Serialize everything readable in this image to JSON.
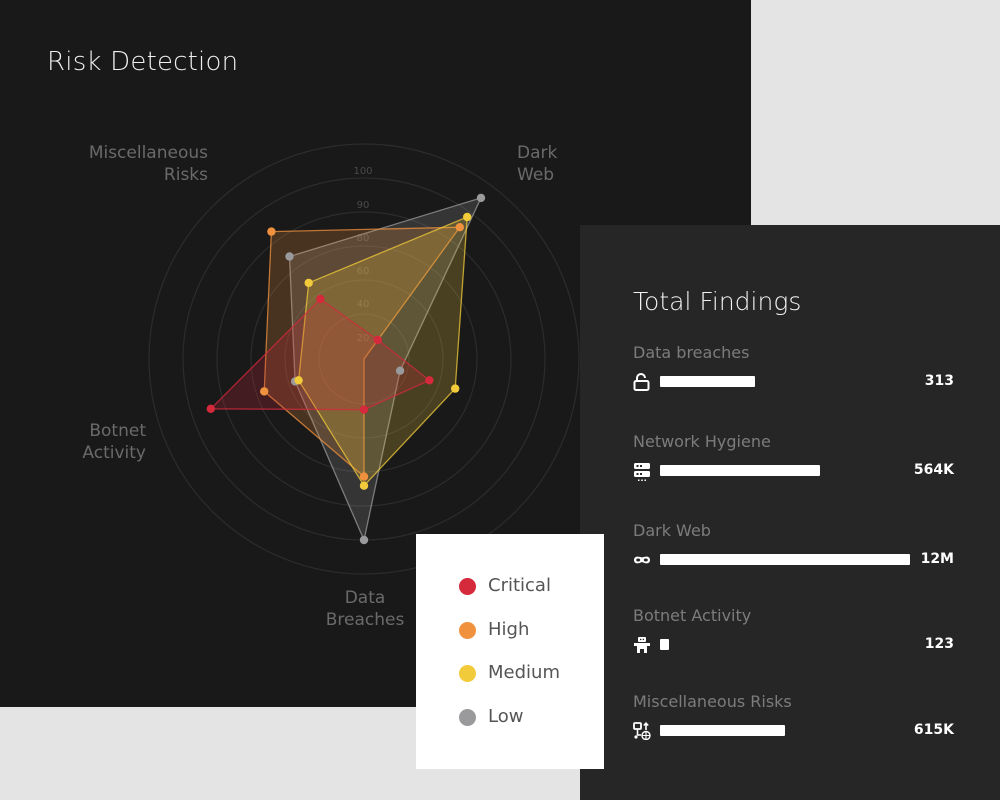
{
  "main": {
    "title": "Risk Detection"
  },
  "chart_data": {
    "type": "radar",
    "title": "Risk Detection",
    "axes": [
      "Data Breaches",
      "Botnet Activity",
      "Miscellaneous Risks",
      "Dark Web",
      "Network Hygiene"
    ],
    "axis_labels_visible": {
      "dark_web": [
        "Dark",
        "Web"
      ],
      "misc": [
        "Miscellaneous",
        "Risks"
      ],
      "botnet": [
        "Botnet",
        "Activity"
      ],
      "data_breaches": [
        "Data",
        "Breaches"
      ]
    },
    "tick_labels": [
      "100",
      "90",
      "80",
      "60",
      "40",
      "20"
    ],
    "range": [
      0,
      100
    ],
    "grid": true,
    "legend_position": "bottom-right",
    "series": [
      {
        "name": "Critical",
        "color": "#d42a3c",
        "values": [
          28,
          89,
          41,
          13,
          38
        ]
      },
      {
        "name": "High",
        "color": "#f0913e",
        "values": [
          65,
          58,
          87,
          90,
          0
        ]
      },
      {
        "name": "Medium",
        "color": "#f2cb3a",
        "values": [
          70,
          38,
          52,
          97,
          53
        ]
      },
      {
        "name": "Low",
        "color": "#9a9a9c",
        "values": [
          100,
          40,
          70,
          110,
          21
        ]
      }
    ]
  },
  "findings": {
    "title": "Total Findings",
    "items": [
      {
        "label": "Data breaches",
        "icon": "unlocked-padlock-icon",
        "value": "313",
        "fraction": 0.38
      },
      {
        "label": "Network Hygiene",
        "icon": "server-rack-icon",
        "value": "564K",
        "fraction": 0.64
      },
      {
        "label": "Dark Web",
        "icon": "mask-icon",
        "value": "12M",
        "fraction": 1.0
      },
      {
        "label": "Botnet Activity",
        "icon": "robot-icon",
        "value": "123",
        "fraction": 0.036
      },
      {
        "label": "Miscellaneous Risks",
        "icon": "network-globe-icon",
        "value": "615K",
        "fraction": 0.5
      }
    ]
  },
  "legend": {
    "items": [
      {
        "label": "Critical",
        "color": "#d42a3c"
      },
      {
        "label": "High",
        "color": "#f0913e"
      },
      {
        "label": "Medium",
        "color": "#f2cb3a"
      },
      {
        "label": "Low",
        "color": "#9a9a9c"
      }
    ]
  }
}
